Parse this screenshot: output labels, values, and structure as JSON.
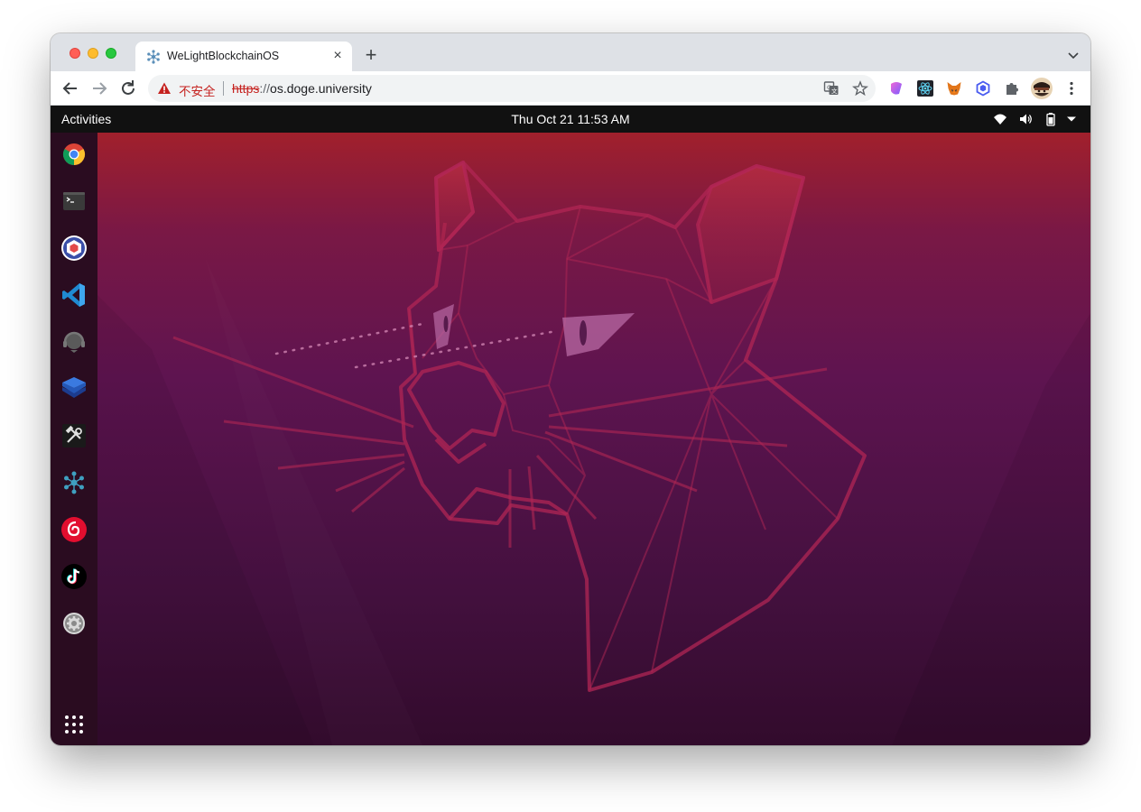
{
  "browser": {
    "tab": {
      "title": "WeLightBlockchainOS",
      "favicon": "hexagon-network-icon"
    },
    "new_tab_label": "+",
    "close_tab_label": "×",
    "address": {
      "security_label": "不安全",
      "scheme": "https",
      "separator": "://",
      "host": "os.doge.university"
    },
    "toolbar_icons": [
      "back-icon",
      "forward-icon",
      "reload-icon",
      "translate-icon",
      "star-icon"
    ],
    "extensions": [
      "gradient-extension-icon",
      "react-devtools-icon",
      "metamask-fox-icon",
      "hexagon-extension-icon",
      "puzzle-icon",
      "profile-avatar",
      "kebab-menu-icon"
    ]
  },
  "ubuntu": {
    "topbar": {
      "activities": "Activities",
      "clock": "Thu Oct 21  11:53 AM",
      "tray": [
        "wifi-icon",
        "volume-icon",
        "battery-icon",
        "dropdown-icon"
      ]
    },
    "dock": {
      "apps": [
        {
          "name": "chrome",
          "icon": "chrome-icon"
        },
        {
          "name": "terminal",
          "icon": "terminal-icon"
        },
        {
          "name": "remix",
          "icon": "cube-app-icon"
        },
        {
          "name": "vscode",
          "icon": "vscode-icon"
        },
        {
          "name": "support",
          "icon": "headset-icon"
        },
        {
          "name": "layers",
          "icon": "layers-icon"
        },
        {
          "name": "tools",
          "icon": "tools-icon"
        },
        {
          "name": "blockchain",
          "icon": "network-icon"
        },
        {
          "name": "netease-music",
          "icon": "music-icon"
        },
        {
          "name": "tiktok",
          "icon": "tiktok-icon"
        },
        {
          "name": "settings",
          "icon": "settings-icon"
        }
      ],
      "show_apps": "grid-icon"
    },
    "wallpaper": "ubuntu-focal-fossa-cat"
  },
  "colors": {
    "accent_red": "#c5221f",
    "topbar": "#111111",
    "dock": "#2a0c20",
    "wallpaper_top": "#a1202c",
    "wallpaper_bottom": "#320b2c"
  }
}
